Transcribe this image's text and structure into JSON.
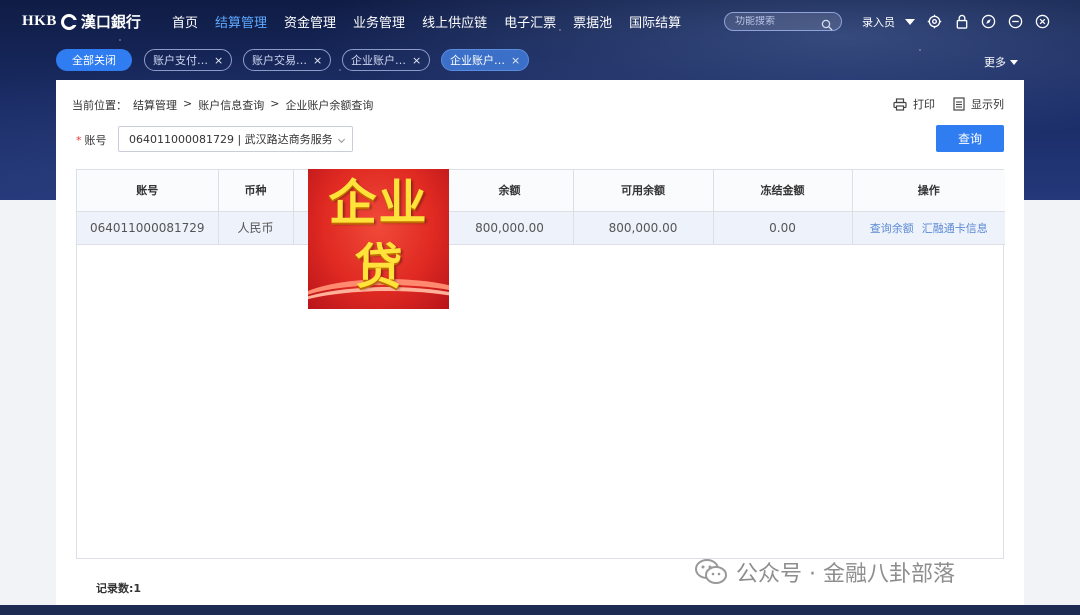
{
  "colors": {
    "accent": "#2f7df0",
    "nav_active": "#5fa9ff",
    "link": "#5b8ad6",
    "required": "#e33333",
    "promo_red": "#e02a22",
    "promo_yellow": "#ffe23a"
  },
  "topnav": {
    "logo_latin": "HKB",
    "logo_chinese": "漢口銀行",
    "items": [
      "首页",
      "结算管理",
      "资金管理",
      "业务管理",
      "线上供应链",
      "电子汇票",
      "票据池",
      "国际结算"
    ],
    "active_index": 1,
    "search_placeholder": "功能搜索",
    "user_label": "录入员",
    "icons": [
      "gear-icon",
      "lock-icon",
      "compass-icon",
      "minus-circle-icon",
      "close-circle-icon"
    ]
  },
  "tabs": {
    "close_all": "全部关闭",
    "items": [
      "账户支付…",
      "账户交易…",
      "企业账户…",
      "企业账户…"
    ],
    "active_index": 3,
    "close_glyph": "×",
    "more": "更多"
  },
  "page": {
    "breadcrumb": [
      "当前位置：",
      "结算管理",
      ">",
      "账户信息查询",
      ">",
      "企业账户余额查询"
    ],
    "print_label": "打印",
    "columns_label": "显示列",
    "account_label": "账号",
    "account_required_mark": "*",
    "account_value": "064011000081729 | 武汉路达商务服务",
    "query_button": "查询"
  },
  "table": {
    "headers": [
      "账号",
      "币种",
      "",
      "余额",
      "可用余额",
      "冻结金额",
      "操作"
    ],
    "rows": [
      {
        "account": "064011000081729",
        "currency": "人民币",
        "balance": "800,000.00",
        "available": "800,000.00",
        "frozen": "0.00",
        "actions": [
          "查询余额",
          "汇融通卡信息"
        ]
      }
    ]
  },
  "footer": {
    "records_label": "记录数:1"
  },
  "overlay_image": {
    "line1": "企业",
    "line2": "贷"
  },
  "watermark": {
    "text": "公众号 · 金融八卦部落"
  }
}
